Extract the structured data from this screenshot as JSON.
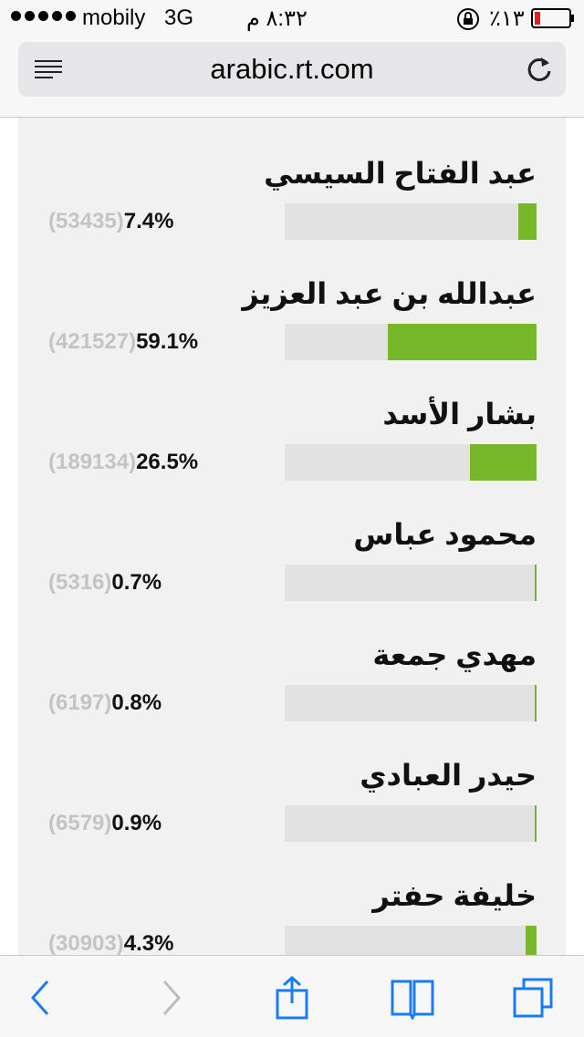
{
  "status_bar": {
    "carrier": "mobily",
    "network": "3G",
    "time": "٨:٣٢ م",
    "battery_percent": "٪١٣",
    "signal_bars": 5,
    "battery_color": "#e0201c"
  },
  "browser": {
    "url": "arabic.rt.com"
  },
  "poll": {
    "accent_color": "#76b82a",
    "candidates": [
      {
        "name": "عبد الفتاح السيسي",
        "percent": "7.4%",
        "votes": "(53435)",
        "share": 0.074
      },
      {
        "name": "عبدالله بن عبد العزيز",
        "percent": "59.1%",
        "votes": "(421527)",
        "share": 0.591
      },
      {
        "name": "بشار الأسد",
        "percent": "26.5%",
        "votes": "(189134)",
        "share": 0.265
      },
      {
        "name": "محمود عباس",
        "percent": "0.7%",
        "votes": "(5316)",
        "share": 0.007
      },
      {
        "name": "مهدي جمعة",
        "percent": "0.8%",
        "votes": "(6197)",
        "share": 0.008
      },
      {
        "name": "حيدر العبادي",
        "percent": "0.9%",
        "votes": "(6579)",
        "share": 0.009
      },
      {
        "name": "خليفة حفتر",
        "percent": "4.3%",
        "votes": "(30903)",
        "share": 0.043
      }
    ]
  },
  "toolbar": {
    "icons": [
      "back-icon",
      "forward-icon",
      "share-icon",
      "bookmarks-icon",
      "tabs-icon"
    ]
  }
}
